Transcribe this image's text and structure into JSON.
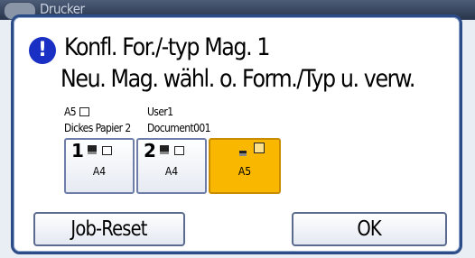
{
  "background_window": {
    "title": "Drucker"
  },
  "dialog": {
    "alert_symbol": "!",
    "message_line1": "Konfl. For./-typ Mag. 1",
    "message_line2": "Neu. Mag. wähl. o. Form./Typ u. verw.",
    "job": {
      "paper_size": "A5",
      "user": "User1",
      "paper_type": "Dickes Papier 2",
      "document": "Document001"
    },
    "trays": [
      {
        "number": "1",
        "size": "A4",
        "selected": false
      },
      {
        "number": "2",
        "size": "A4",
        "selected": false
      },
      {
        "number": "",
        "size": "A5",
        "selected": true
      }
    ],
    "buttons": {
      "job_reset": "Job-Reset",
      "ok": "OK"
    }
  },
  "colors": {
    "frame": "#2b4c86",
    "alert": "#1a2fc4",
    "selected_tray": "#f9b700"
  }
}
